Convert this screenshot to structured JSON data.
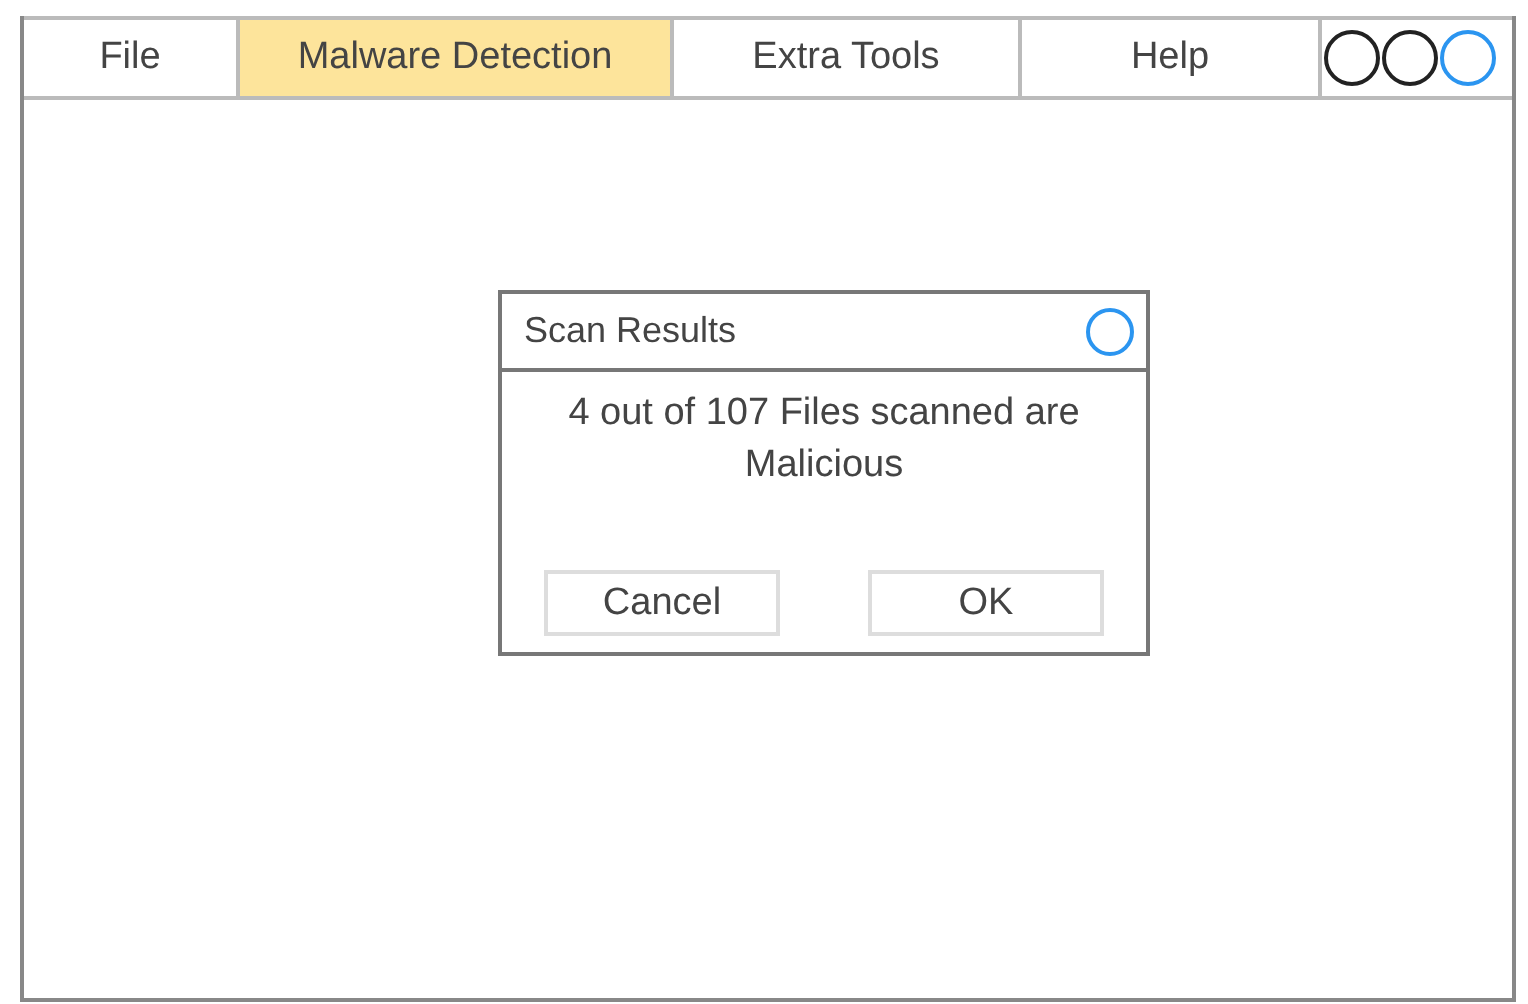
{
  "menu": [
    {
      "label": "File",
      "selected": false
    },
    {
      "label": "Malware Detection",
      "selected": true
    },
    {
      "label": "Extra Tools",
      "selected": false
    },
    {
      "label": "Help",
      "selected": false
    }
  ],
  "window_controls": [
    {
      "color": "#222222"
    },
    {
      "color": "#222222"
    },
    {
      "color": "#2b95f0"
    }
  ],
  "dialog": {
    "title": "Scan Results",
    "message": "4 out of 107 Files scanned are Malicious",
    "buttons": [
      "Cancel",
      "OK"
    ]
  }
}
